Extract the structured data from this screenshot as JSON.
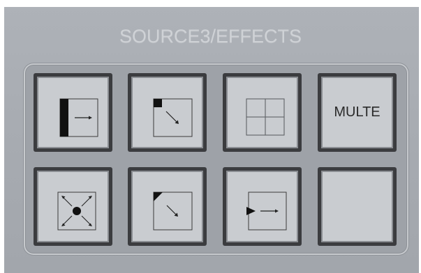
{
  "panel": {
    "title": "SOURCE3/EFFECTS"
  },
  "buttons": [
    {
      "id": "wipe-left",
      "icon": "wipe-bar-arrow-right-icon",
      "label": ""
    },
    {
      "id": "corner-wipe",
      "icon": "corner-wipe-arrow-icon",
      "label": ""
    },
    {
      "id": "quad-split",
      "icon": "quad-split-icon",
      "label": ""
    },
    {
      "id": "multe",
      "icon": "",
      "label": "MULTE"
    },
    {
      "id": "center-expand",
      "icon": "center-expand-arrows-icon",
      "label": ""
    },
    {
      "id": "diagonal-wipe",
      "icon": "diagonal-wipe-arrow-icon",
      "label": ""
    },
    {
      "id": "push-right",
      "icon": "push-triangle-arrow-icon",
      "label": ""
    },
    {
      "id": "blank",
      "icon": "",
      "label": ""
    }
  ]
}
